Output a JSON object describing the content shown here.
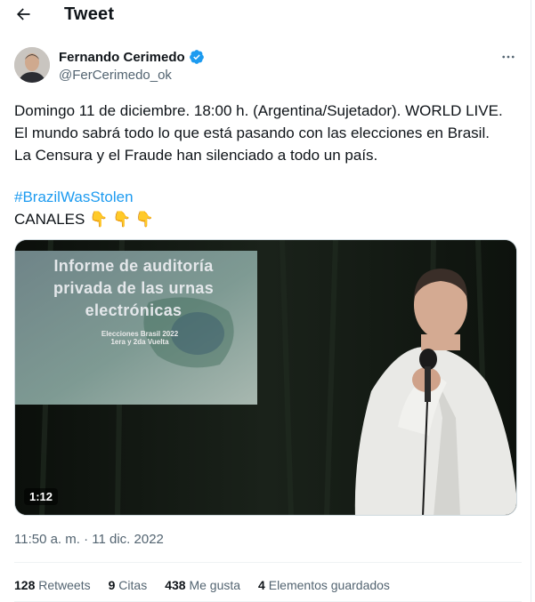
{
  "header": {
    "title": "Tweet",
    "back_icon": "arrow-left-icon"
  },
  "author": {
    "name": "Fernando Cerimedo",
    "handle": "@FerCerimedo_ok",
    "verified_icon": "verified-badge-icon",
    "more_icon": "more-horizontal-icon"
  },
  "tweet": {
    "lines": [
      "Domingo 11 de diciembre. 18:00 h. (Argentina/Sujetador). WORLD LIVE.",
      "El mundo sabrá todo lo que está pasando con las elecciones en Brasil.",
      "La Censura y el Fraude han silenciado a todo un país."
    ],
    "hashtag": "#BrazilWasStolen",
    "canales": "CANALES",
    "emoji": "👇 👇 👇"
  },
  "media": {
    "slide_line1": "Informe de auditoría",
    "slide_line2": "privada de las urnas",
    "slide_line3": "electrónicas",
    "slide_sub1": "Elecciones Brasil 2022",
    "slide_sub2": "1era y 2da Vuelta",
    "duration": "1:12"
  },
  "meta": {
    "timestamp": "11:50 a. m. · 11 dic. 2022"
  },
  "stats": {
    "retweets_count": "128",
    "retweets_label": "Retweets",
    "quotes_count": "9",
    "quotes_label": "Citas",
    "likes_count": "438",
    "likes_label": "Me gusta",
    "bookmarks_count": "4",
    "bookmarks_label": "Elementos guardados"
  },
  "colors": {
    "accent": "#1d9bf0",
    "text": "#0f1419",
    "muted": "#536471"
  }
}
